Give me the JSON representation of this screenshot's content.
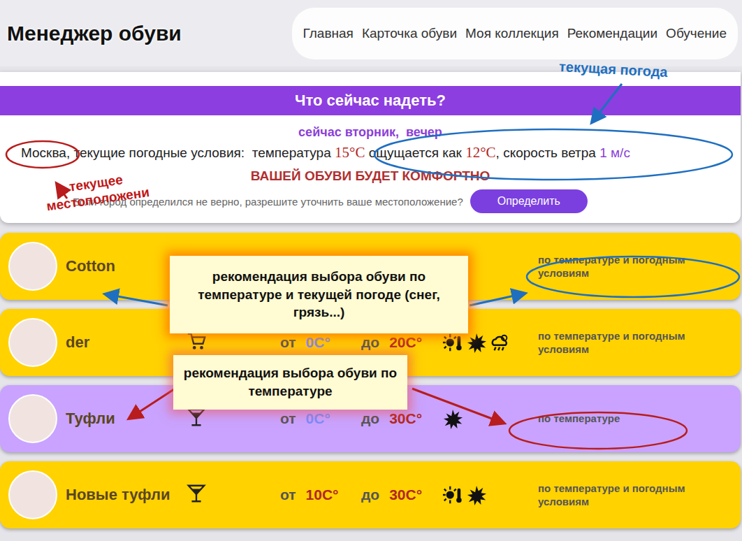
{
  "header": {
    "title": "Менеджер обуви",
    "nav": [
      {
        "label": "Главная",
        "selected": false
      },
      {
        "label": "Карточка обуви",
        "selected": false
      },
      {
        "label": "Моя коллекция",
        "selected": false
      },
      {
        "label": "Рекомендации",
        "selected": false
      },
      {
        "label": "Обучение",
        "selected": false
      }
    ]
  },
  "weather_panel": {
    "heading": "Что сейчас надеть?",
    "day": "сейчас вторник,  вечер",
    "city": "Москва",
    "conditions_label": ", текущие погодные условия:  температура ",
    "temperature": "15°С",
    "feels_label": " ощущается как ",
    "feels": "12°С",
    "wind_label": ", скорость ветра ",
    "wind": "1 м/с",
    "verdict": "ВАШЕЙ ОБУВИ БУДЕТ КОМФОРТНО",
    "hint": "Если город определился не верно, разрешите уточнить ваше местоположение?",
    "button": "Определить"
  },
  "shoes": [
    {
      "name": "Cotton",
      "occasion": null,
      "from_label": null,
      "from": null,
      "to_label": null,
      "to": null,
      "conditions": [
        "sun"
      ],
      "recommendation": "по температуре и погодным условиям",
      "color": "#ffd200"
    },
    {
      "name": "der",
      "occasion": "shopping",
      "from_label": "от",
      "from": "0C°",
      "to_label": "до",
      "to": "20C°",
      "conditions": [
        "sun",
        "splash",
        "rain"
      ],
      "recommendation": "по температуре и погодным условиям",
      "color": "#ffd200"
    },
    {
      "name": "Туфли",
      "occasion": "party",
      "from_label": "от",
      "from": "0C°",
      "to_label": "до",
      "to": "30C°",
      "conditions": [
        "splash"
      ],
      "recommendation": "по температуре",
      "color": "#c9a3ff"
    },
    {
      "name": "Новые туфли",
      "occasion": "party",
      "from_label": "от",
      "from": "10C°",
      "to_label": "до",
      "to": "30C°",
      "conditions": [
        "sun",
        "splash"
      ],
      "recommendation": "по температуре и погодным условиям",
      "color": "#ffd200"
    }
  ],
  "annotations": {
    "weather_label": "текущая погода",
    "location_lines": [
      "текущее",
      "местоположени"
    ],
    "callout_weather": "рекомендация выбора обуви по температуре и текущей погоде (снег, грязь...)",
    "callout_temperature": "рекомендация выбора обуви по температуре"
  }
}
